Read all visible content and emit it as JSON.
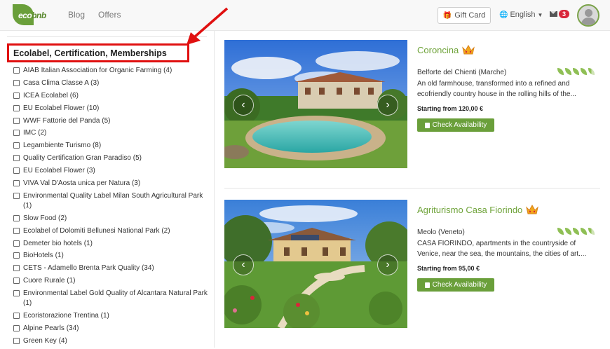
{
  "navbar": {
    "logo": {
      "eco": "eco",
      "bnb": "bnb"
    },
    "links": [
      "Blog",
      "Offers"
    ],
    "gift_card": "Gift Card",
    "language": "English",
    "messages_count": "3",
    "icons": {
      "gift": "gift-icon",
      "language": "globe-icon",
      "messages": "envelope-icon",
      "avatar": "user-avatar"
    }
  },
  "sidebar": {
    "filter_title": "Ecolabel, Certification, Memberships",
    "items": [
      "AIAB Italian Association for Organic Farming (4)",
      "Casa Clima Classe A (3)",
      "ICEA Ecolabel (6)",
      "EU Ecolabel Flower (10)",
      "WWF Fattorie del Panda (5)",
      "IMC (2)",
      "Legambiente Turismo (8)",
      "Quality Certification Gran Paradiso (5)",
      "EU Ecolabel Flower (3)",
      "VIVA Val D'Aosta unica per Natura (3)",
      "Environmental Quality Label Milan South Agricultural Park (1)",
      "Slow Food (2)",
      "Ecolabel of Dolomiti Bellunesi National Park (2)",
      "Demeter bio hotels (1)",
      "BioHotels (1)",
      "CETS - Adamello Brenta Park Quality (34)",
      "Cuore Rurale (1)",
      "Environmental Label Gold Quality of Alcantara Natural Park (1)",
      "Ecoristorazione Trentina (1)",
      "Alpine Pearls (34)",
      "Green Key (4)"
    ]
  },
  "listings": [
    {
      "title": "Coroncina",
      "location": "Belforte del Chienti (Marche)",
      "description": "An old farmhouse, transformed into a refined and ecofriendly country house in the rolling hills of the...",
      "price": "Starting from 120,00 €",
      "button": "Check Availability",
      "eco_leaves": 4.5,
      "slider": {
        "prev": "‹",
        "next": "›"
      }
    },
    {
      "title": "Agriturismo Casa Fiorindo",
      "location": "Meolo (Veneto)",
      "description": "CASA FIORINDO, apartments in the countryside of Venice, near the sea, the mountains, the cities of art....",
      "price": "Starting from 95,00 €",
      "button": "Check Availability",
      "eco_leaves": 4.5,
      "slider": {
        "prev": "‹",
        "next": "›"
      }
    }
  ],
  "colors": {
    "brand_green": "#6a9f3a",
    "title_green": "#6fa33a",
    "badge_red": "#d9263a",
    "annotation_red": "#e01010"
  }
}
